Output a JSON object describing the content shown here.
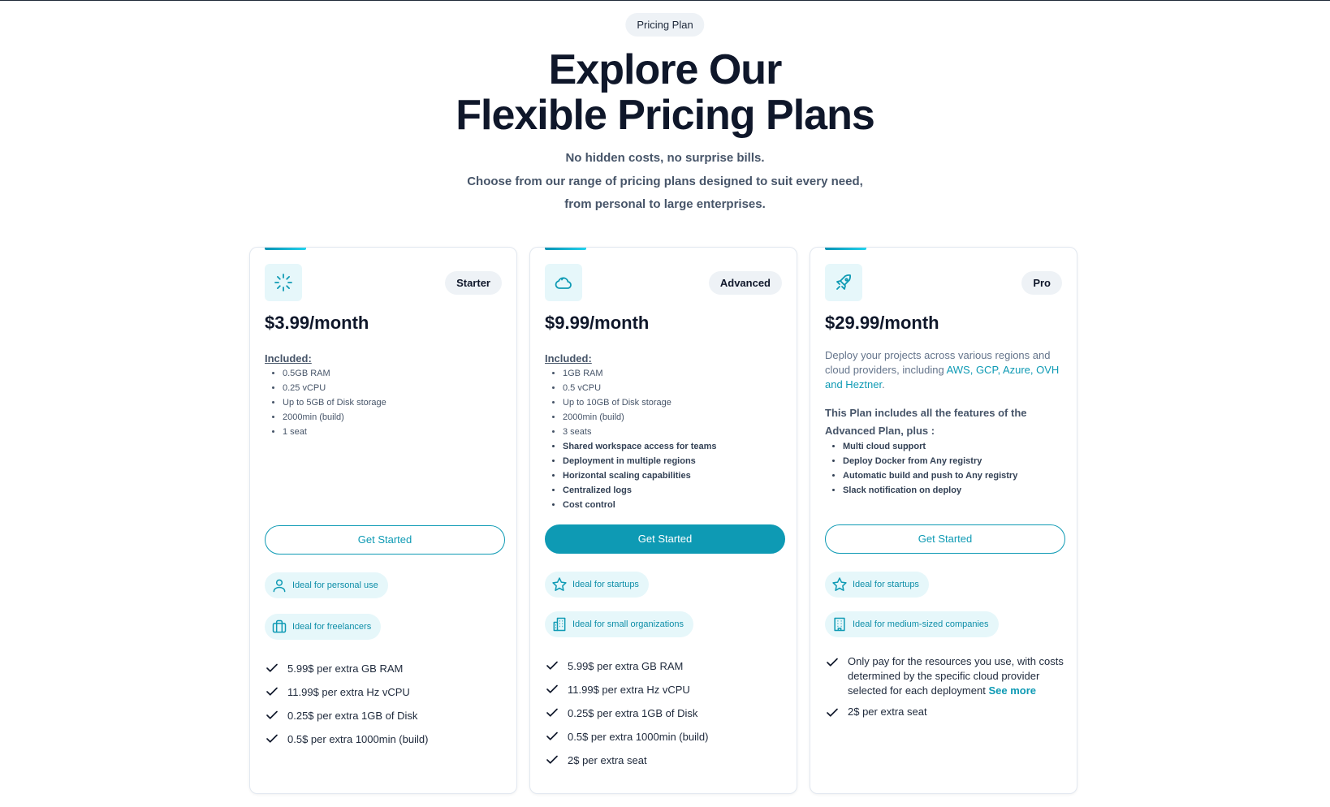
{
  "header": {
    "badge": "Pricing Plan",
    "title_line1": "Explore Our",
    "title_line2": "Flexible Pricing Plans",
    "sub_line1": "No hidden costs, no surprise bills.",
    "sub_line2": "Choose from our range of pricing plans designed to suit every need,",
    "sub_line3": "from personal to large enterprises."
  },
  "colors": {
    "accent": "#0e9ab4",
    "pill_bg": "#e6f7fa",
    "heading": "#0f172a",
    "muted": "#475569"
  },
  "plans": [
    {
      "icon": "loader-icon",
      "tier": "Starter",
      "price": "$3.99/month",
      "included_label": "Included:",
      "features": [
        "0.5GB RAM",
        "0.25 vCPU",
        "Up to 5GB of Disk storage",
        "2000min (build)",
        "1 seat"
      ],
      "cta": "Get Started",
      "pills": [
        {
          "icon": "user-icon",
          "label": "Ideal for personal use"
        },
        {
          "icon": "briefcase-icon",
          "label": "Ideal for freelancers"
        }
      ],
      "extras": [
        "5.99$ per extra GB RAM",
        "11.99$ per extra Hz vCPU",
        "0.25$ per extra 1GB of Disk",
        "0.5$ per extra 1000min (build)"
      ]
    },
    {
      "icon": "cloud-icon",
      "tier": "Advanced",
      "price": "$9.99/month",
      "included_label": "Included:",
      "features": [
        "1GB RAM",
        "0.5 vCPU",
        "Up to 10GB of Disk storage",
        "2000min (build)",
        "3 seats"
      ],
      "features_bold": [
        "Shared workspace access for teams",
        "Deployment in multiple regions",
        "Horizontal scaling capabilities",
        "Centralized logs",
        "Cost control"
      ],
      "cta": "Get Started",
      "pills": [
        {
          "icon": "star-icon",
          "label": "Ideal for startups"
        },
        {
          "icon": "building-icon",
          "label": "Ideal for small organizations"
        }
      ],
      "extras": [
        "5.99$ per extra GB RAM",
        "11.99$ per extra Hz vCPU",
        "0.25$ per extra 1GB of Disk",
        "0.5$ per extra 1000min (build)",
        "2$ per extra seat"
      ]
    },
    {
      "icon": "rocket-icon",
      "tier": "Pro",
      "price": "$29.99/month",
      "desc_pre": "Deploy your projects across various regions and cloud providers, including ",
      "desc_link": "AWS, GCP, Azure, OVH and Heztner",
      "desc_post": ".",
      "plus_text": "This Plan includes all the features of the Advanced Plan, plus :",
      "features_bold": [
        "Multi cloud support",
        "Deploy Docker from Any registry",
        "Automatic build and push to Any registry",
        "Slack notification on deploy"
      ],
      "cta": "Get Started",
      "pills": [
        {
          "icon": "star-icon",
          "label": "Ideal for startups"
        },
        {
          "icon": "office-building-icon",
          "label": "Ideal for medium-sized companies"
        }
      ],
      "extra_resources": "Only pay for the resources you use, with costs determined by the specific cloud provider selected for each deployment",
      "see_more": "See more",
      "extra_seat": "2$ per extra seat"
    }
  ]
}
